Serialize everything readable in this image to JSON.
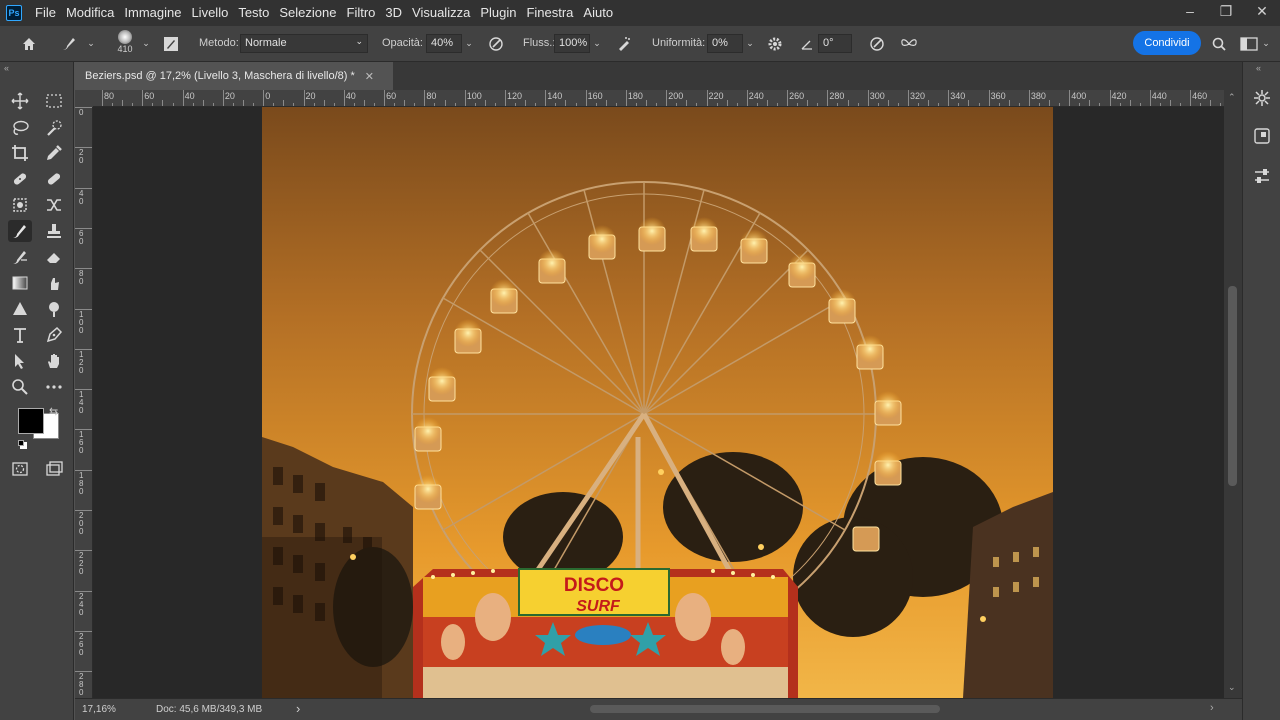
{
  "menu": [
    "File",
    "Modifica",
    "Immagine",
    "Livello",
    "Testo",
    "Selezione",
    "Filtro",
    "3D",
    "Visualizza",
    "Plugin",
    "Finestra",
    "Aiuto"
  ],
  "app_logo": "Ps",
  "window_controls": {
    "minimize": "–",
    "restore": "❐",
    "close": "✕"
  },
  "options": {
    "brush_size": "410",
    "mode_label": "Metodo:",
    "mode_value": "Normale",
    "opacity_label": "Opacità:",
    "opacity_value": "40%",
    "flow_label": "Fluss.:",
    "flow_value": "100%",
    "smoothing_label": "Uniformità:",
    "smoothing_value": "0%",
    "angle_value": "0°",
    "share_label": "Condividi"
  },
  "document": {
    "tab_title": "Beziers.psd @ 17,2% (Livello 3, Maschera di livello/8) *",
    "close_glyph": "✕"
  },
  "ruler_top_labels": [
    "80",
    "60",
    "40",
    "20",
    "0",
    "20",
    "40",
    "60",
    "80",
    "100",
    "120",
    "140",
    "160",
    "180",
    "200",
    "220",
    "240",
    "260",
    "280",
    "300",
    "320",
    "340",
    "360",
    "380",
    "400",
    "420",
    "440",
    "460"
  ],
  "ruler_left_labels": [
    "0",
    "2\n0",
    "4\n0",
    "6\n0",
    "8\n0",
    "1\n0\n0",
    "1\n2\n0",
    "1\n4\n0",
    "1\n6\n0",
    "1\n8\n0",
    "2\n0\n0",
    "2\n2\n0",
    "2\n4\n0",
    "2\n6\n0",
    "2\n8\n0"
  ],
  "status": {
    "zoom": "17,16%",
    "doc_info": "Doc: 45,6 MB/349,3 MB",
    "arrow": "›"
  },
  "sign": {
    "line1": "DISCO",
    "line2": "SURF"
  },
  "colors": {
    "accent": "#1473e6",
    "foreground": "#000000",
    "background": "#ffffff"
  }
}
